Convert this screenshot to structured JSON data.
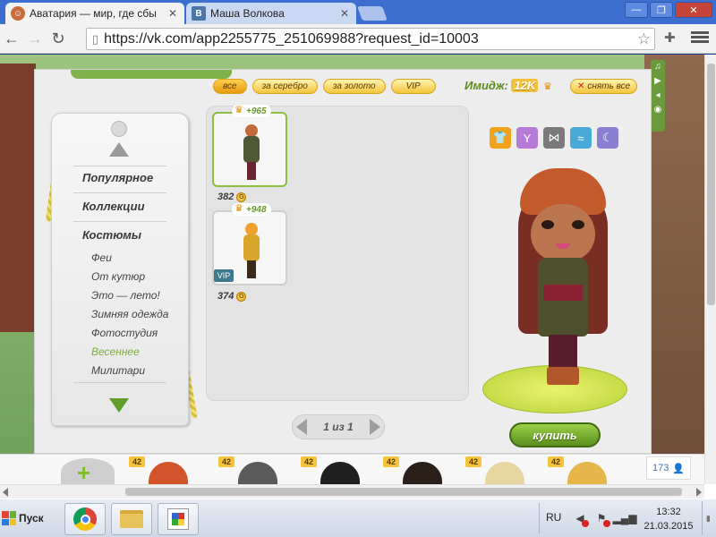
{
  "browser": {
    "tabs": [
      {
        "title": "Аватария — мир, где сбы",
        "icon": "avataria-favicon",
        "active": true
      },
      {
        "title": "Маша Волкова",
        "icon": "vk-favicon",
        "active": false
      }
    ],
    "vk_favicon_letter": "B",
    "url": "https://vk.com/app2255775_251069988?request_id=10003"
  },
  "shop": {
    "filters": [
      "все",
      "за серебро",
      "за золото",
      "VIP"
    ],
    "active_filter": "все",
    "image_label": "Имидж:",
    "image_value": "12K",
    "remove_all": "снять все",
    "menu": {
      "categories": [
        "Популярное",
        "Коллекции",
        "Костюмы"
      ],
      "subcategories": [
        "Феи",
        "От кутюр",
        "Это — лето!",
        "Зимняя одежда",
        "Фотостудия",
        "Весеннее",
        "Милитари"
      ],
      "selected_subcategory": "Весеннее"
    },
    "items": [
      {
        "bonus": "+965",
        "price": "382",
        "vip": false,
        "selected": true,
        "outfit_color": "#4f5a34"
      },
      {
        "bonus": "+948",
        "price": "374",
        "vip": true,
        "vip_label": "VIP",
        "selected": false,
        "outfit_color": "#d9a52a"
      }
    ],
    "pager": "1 из 1",
    "buy_label": "купить",
    "category_icons": [
      {
        "name": "shirt-icon",
        "color": "#f2a31c"
      },
      {
        "name": "cocktail-icon",
        "color": "#b57bd6"
      },
      {
        "name": "bowtie-icon",
        "color": "#7a7a7a"
      },
      {
        "name": "waves-icon",
        "color": "#49a9d8"
      },
      {
        "name": "moon-icon",
        "color": "#8a7fd0"
      }
    ]
  },
  "friends": {
    "levels": [
      "42",
      "42",
      "42",
      "42",
      "42",
      "42"
    ],
    "online_count": "173"
  },
  "taskbar": {
    "start_label": "Пуск",
    "language": "RU",
    "time": "13:32",
    "date": "21.03.2015"
  },
  "colors": {
    "accent_green": "#7dae3a",
    "gold": "#f4c63a"
  }
}
